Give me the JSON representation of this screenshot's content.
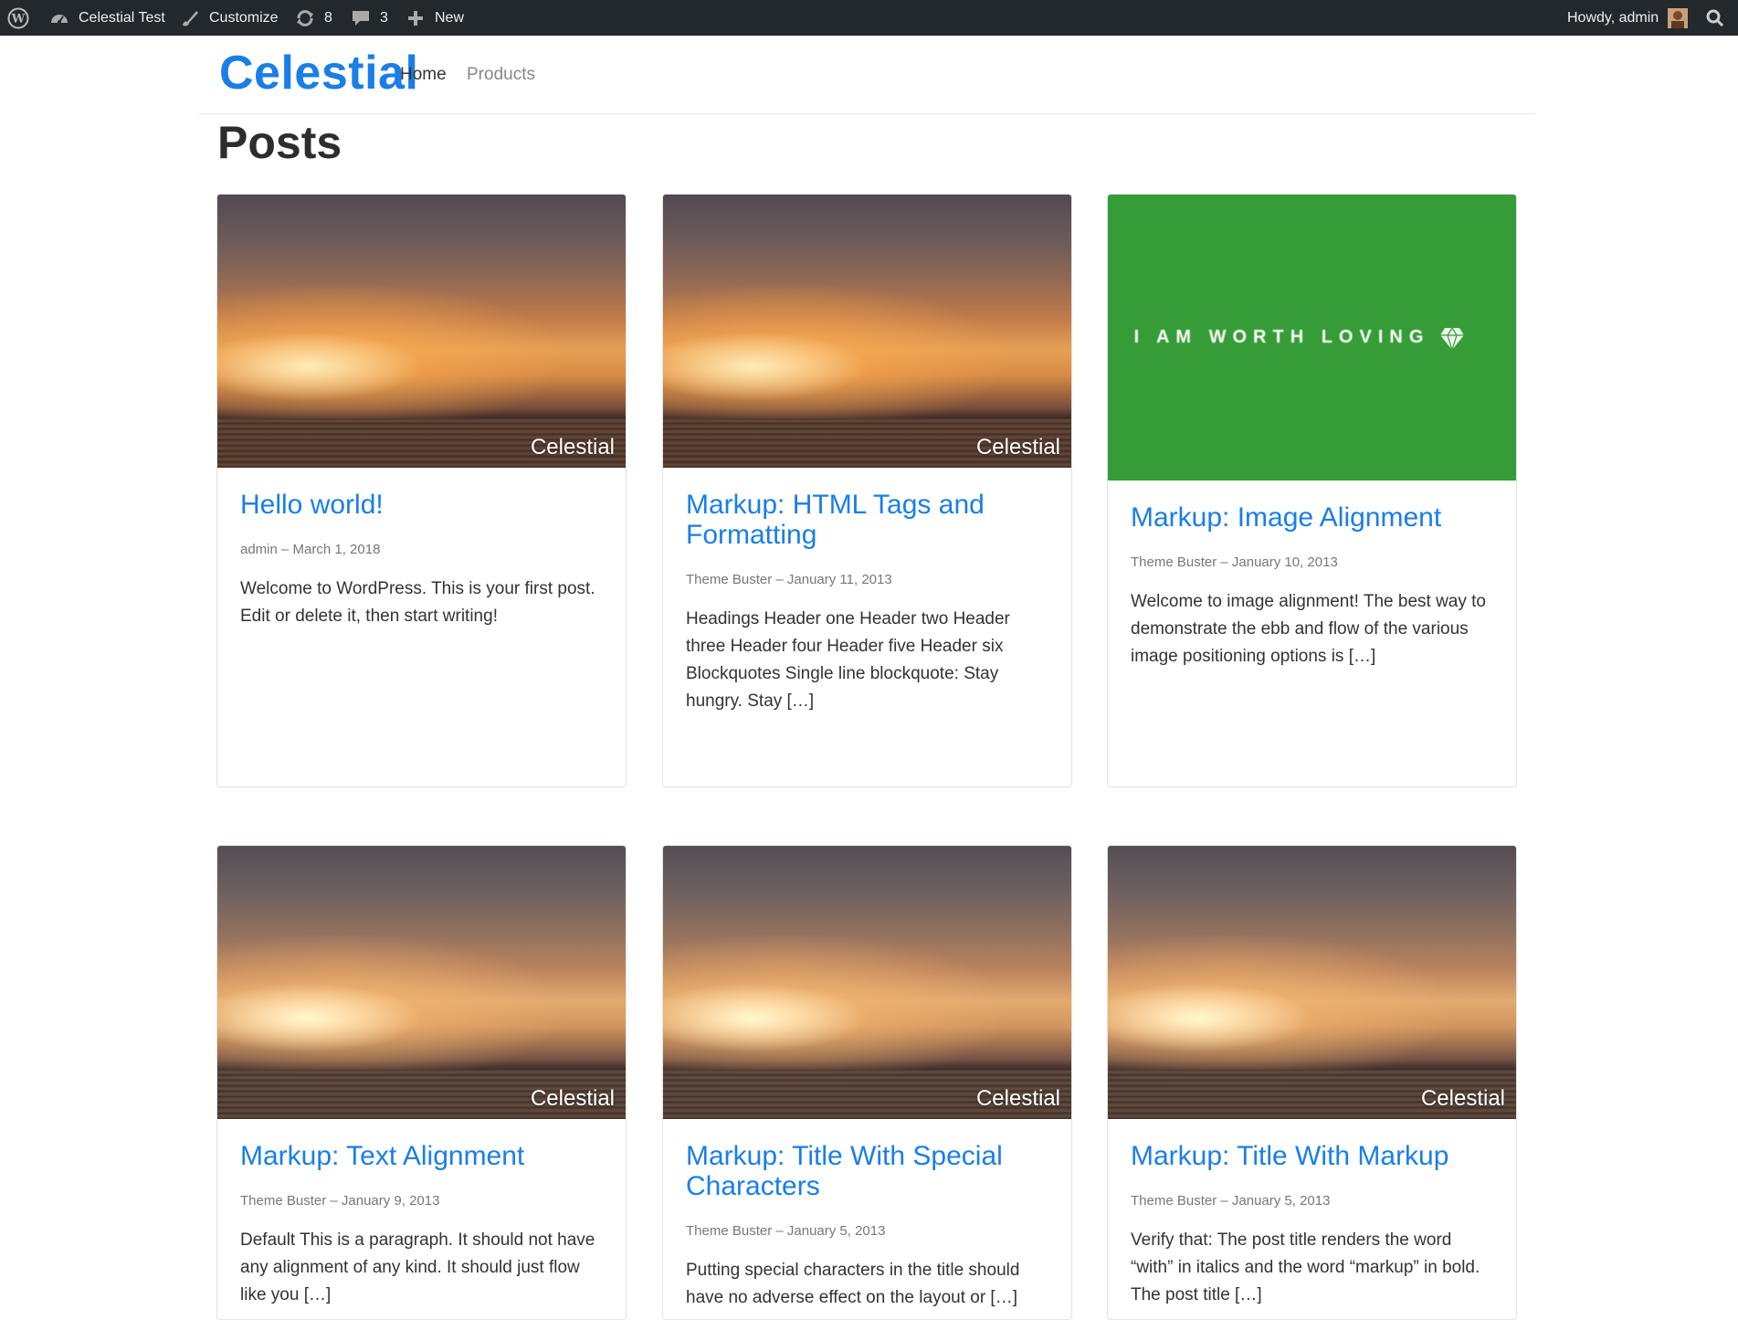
{
  "adminbar": {
    "site_name": "Celestial Test",
    "customize": "Customize",
    "updates_count": "8",
    "comments_count": "3",
    "new_label": "New",
    "howdy": "Howdy, admin"
  },
  "header": {
    "site_title": "Celestial",
    "nav": [
      "Home",
      "Products"
    ]
  },
  "page_title": "Posts",
  "posts": [
    {
      "title": "Hello world!",
      "meta": "admin – March 1, 2018",
      "excerpt": "Welcome to WordPress. This is your first post. Edit or delete it, then start writing!",
      "thumb_caption": "Celestial"
    },
    {
      "title": "Markup: HTML Tags and Formatting",
      "meta": "Theme Buster – January 11, 2013",
      "excerpt": "Headings Header one Header two Header three Header four Header five Header six Blockquotes Single line blockquote: Stay hungry. Stay […]",
      "thumb_caption": "Celestial"
    },
    {
      "title": "Markup: Image Alignment",
      "meta": "Theme Buster – January 10, 2013",
      "excerpt": "Welcome to image alignment! The best way to demonstrate the ebb and flow of the various image positioning options is […]",
      "thumb_text": "I AM WORTH LOVING"
    },
    {
      "title": "Markup: Text Alignment",
      "meta": "Theme Buster – January 9, 2013",
      "excerpt": "Default This is a paragraph. It should not have any alignment of any kind. It should just flow like you […]",
      "thumb_caption": "Celestial"
    },
    {
      "title": "Markup: Title With Special Characters",
      "meta": "Theme Buster – January 5, 2013",
      "excerpt": "Putting special characters in the title should have no adverse effect on the layout or […]",
      "thumb_caption": "Celestial"
    },
    {
      "title": "Markup: Title With Markup",
      "meta": "Theme Buster – January 5, 2013",
      "excerpt": "Verify that: The post title renders the word “with” in italics and the word “markup” in bold. The post title […]",
      "thumb_caption": "Celestial"
    }
  ],
  "colors": {
    "accent": "#1a7ee6",
    "adminbar": "#23282d",
    "green_thumb": "#359c37"
  }
}
